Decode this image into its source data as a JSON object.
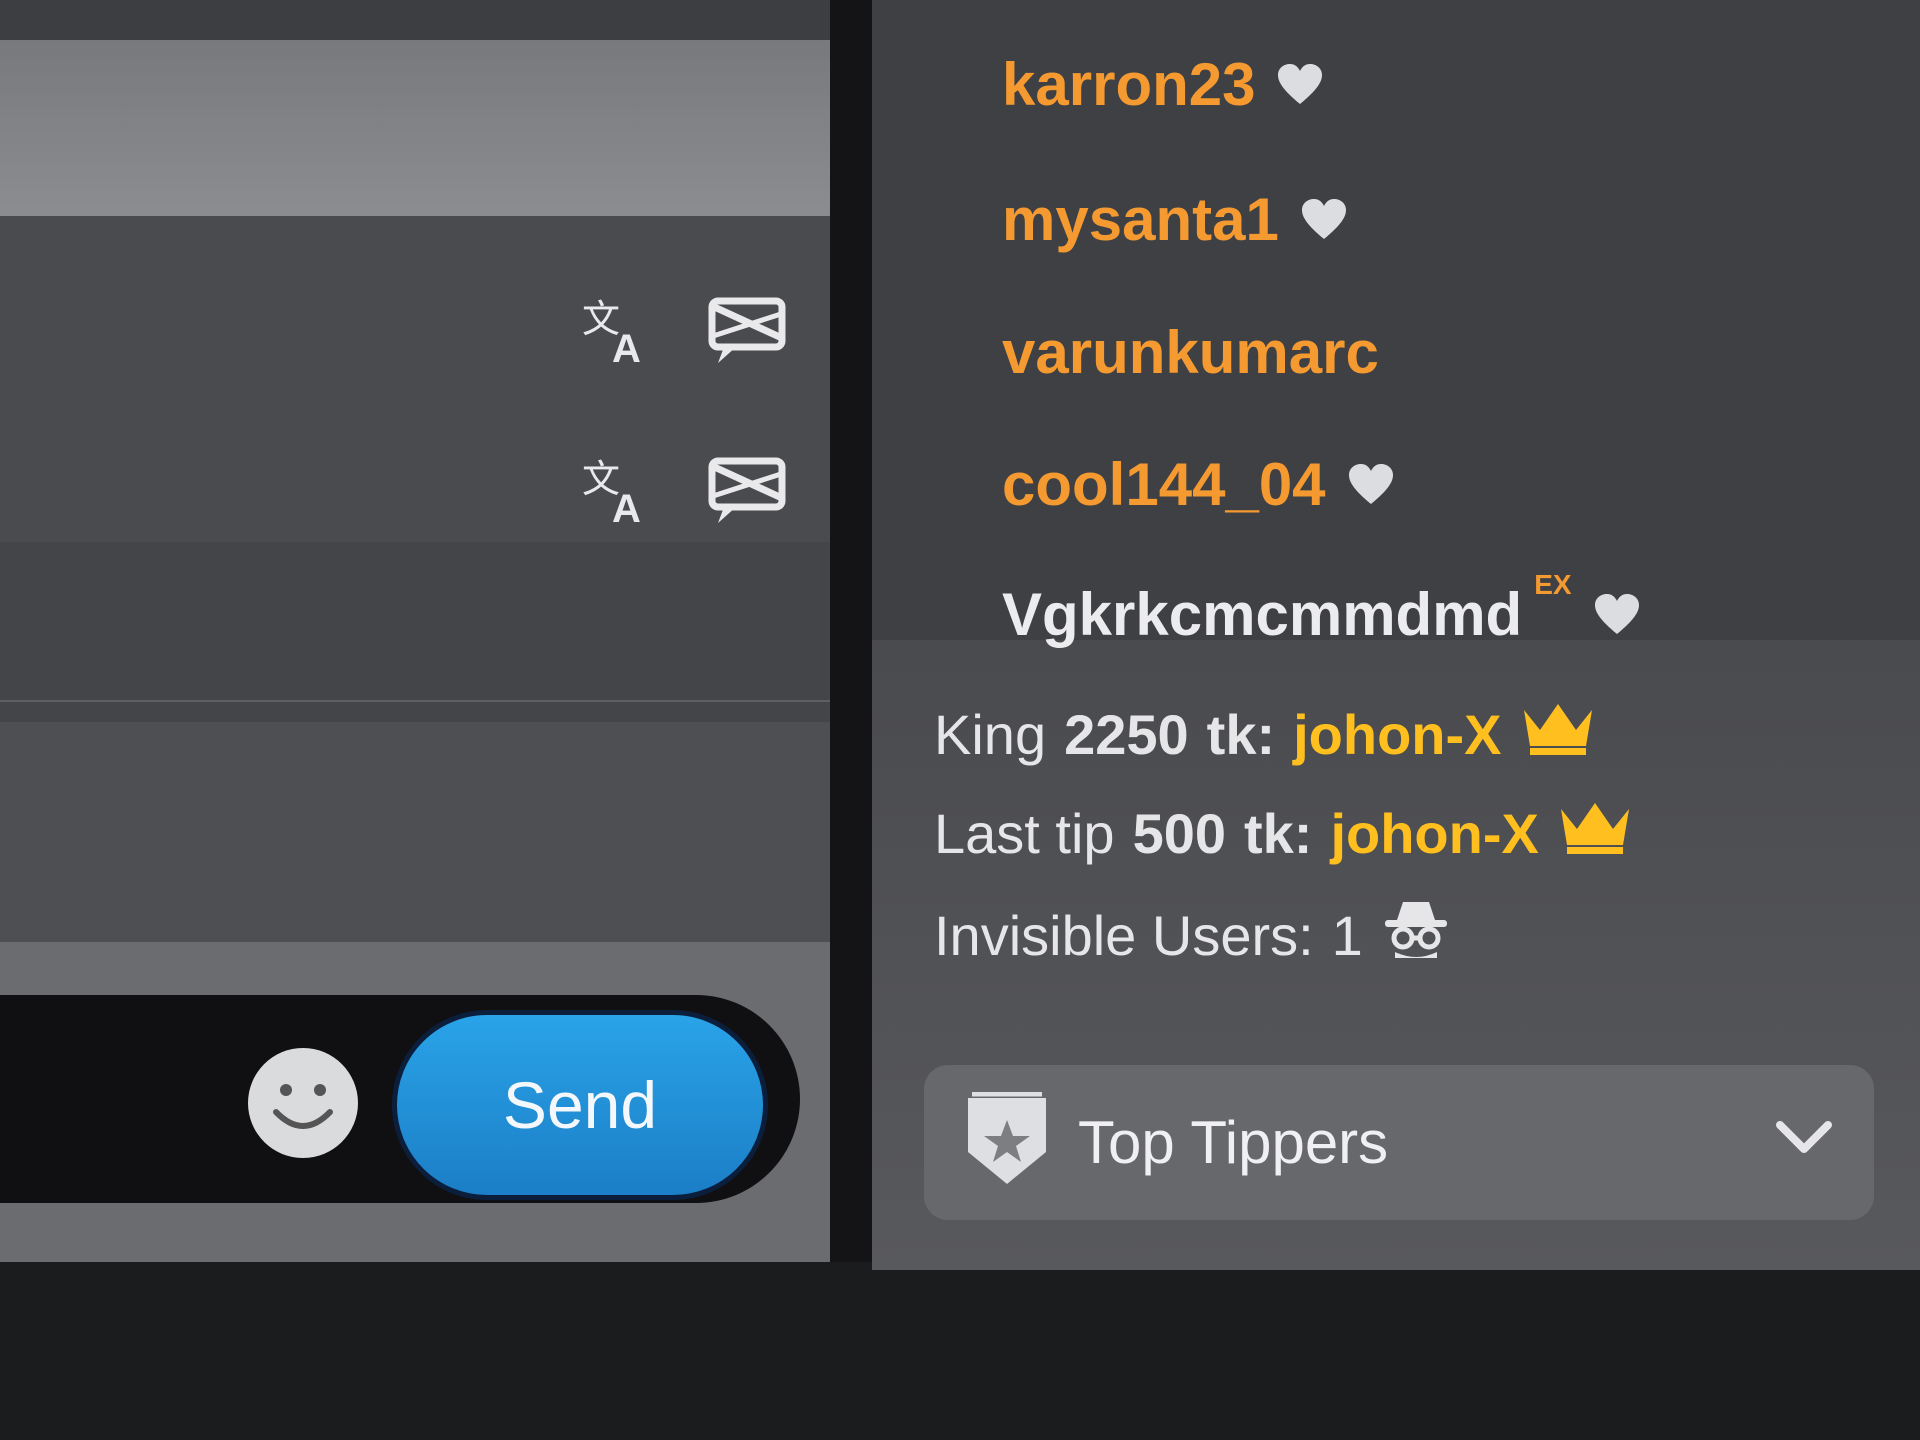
{
  "chat": {
    "input_placeholder": "",
    "send_label": "Send"
  },
  "users": [
    {
      "name": "karron23",
      "heart": true,
      "color": "#f59a31"
    },
    {
      "name": "mysanta1",
      "heart": true,
      "color": "#f59a31"
    },
    {
      "name": "varunkumarc",
      "heart": false,
      "color": "#f59a31"
    },
    {
      "name": "cool144_04",
      "heart": true,
      "color": "#f59a31"
    },
    {
      "name": "Vgkrkcmcmmdmd",
      "badge": "EX",
      "heart": true,
      "color": "#ececee"
    }
  ],
  "stats": {
    "king": {
      "label": "King",
      "amount": "2250",
      "unit": "tk:",
      "user": "johon-X"
    },
    "last_tip": {
      "label": "Last tip",
      "amount": "500",
      "unit": "tk:",
      "user": "johon-X"
    },
    "invisible": {
      "label": "Invisible Users:",
      "count": "1"
    }
  },
  "top_tippers": {
    "label": "Top Tippers"
  },
  "colors": {
    "accent_orange": "#f59a31",
    "gold": "#ffbf1f",
    "send_blue": "#2196dd"
  },
  "icons": [
    "translate-icon",
    "hide-message-icon",
    "smiley-icon",
    "heart-icon",
    "crown-icon",
    "spy-icon",
    "shield-star-icon",
    "chevron-down-icon"
  ]
}
